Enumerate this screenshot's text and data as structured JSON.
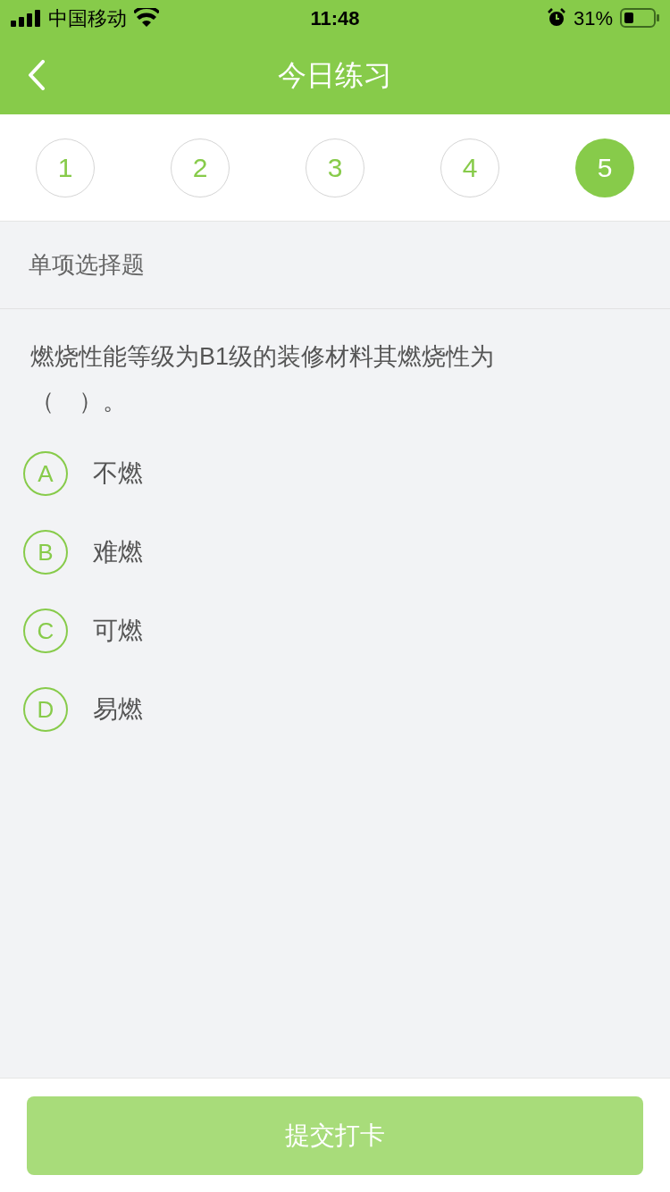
{
  "status_bar": {
    "carrier": "中国移动",
    "time": "11:48",
    "battery": "31%"
  },
  "nav": {
    "title": "今日练习"
  },
  "steps": [
    {
      "label": "1",
      "selected": false
    },
    {
      "label": "2",
      "selected": false
    },
    {
      "label": "3",
      "selected": false
    },
    {
      "label": "4",
      "selected": false
    },
    {
      "label": "5",
      "selected": true
    }
  ],
  "question": {
    "type": "单项选择题",
    "text": "燃烧性能等级为B1级的装修材料其燃烧性为（　）。",
    "options": [
      {
        "letter": "A",
        "text": "不燃",
        "selected": false
      },
      {
        "letter": "B",
        "text": "难燃",
        "selected": false
      },
      {
        "letter": "C",
        "text": "可燃",
        "selected": false
      },
      {
        "letter": "D",
        "text": "易燃",
        "selected": false
      }
    ]
  },
  "submit": {
    "label": "提交打卡",
    "disabled": true
  }
}
